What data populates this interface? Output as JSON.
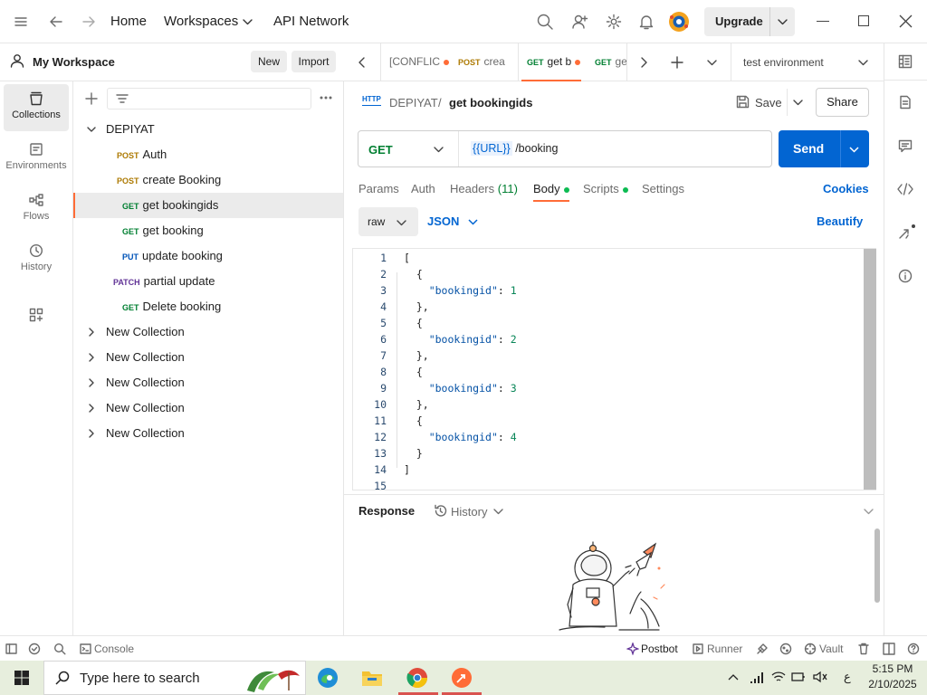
{
  "topbar": {
    "nav": [
      "Home",
      "Workspaces",
      "API Network"
    ],
    "upgrade": "Upgrade"
  },
  "workspace": {
    "name": "My Workspace",
    "new": "New",
    "import": "Import"
  },
  "rail": [
    "Collections",
    "Environments",
    "Flows",
    "History"
  ],
  "tree": {
    "collection": "DEPIYAT",
    "requests": [
      {
        "method": "POST",
        "name": "Auth"
      },
      {
        "method": "POST",
        "name": "create Booking"
      },
      {
        "method": "GET",
        "name": "get bookingids"
      },
      {
        "method": "GET",
        "name": "get booking"
      },
      {
        "method": "PUT",
        "name": "update booking"
      },
      {
        "method": "PATCH",
        "name": "partial update"
      },
      {
        "method": "GET",
        "name": "Delete booking"
      }
    ],
    "others": [
      "New Collection",
      "New Collection",
      "New Collection",
      "New Collection",
      "New Collection"
    ]
  },
  "tabs": [
    {
      "method": "",
      "label": "[CONFLIC"
    },
    {
      "method": "POST",
      "label": "crea"
    },
    {
      "method": "GET",
      "label": "get b"
    },
    {
      "method": "GET",
      "label": "ge"
    }
  ],
  "environment": "test environment",
  "breadcrumb": {
    "collection": "DEPIYAT",
    "sep": "/",
    "request": "get bookingids",
    "badge": "HTTP"
  },
  "actions": {
    "save": "Save",
    "share": "Share"
  },
  "request": {
    "method": "GET",
    "url_var": "{{URL}}",
    "url_path": " /booking",
    "send": "Send"
  },
  "subtabs": {
    "params": "Params",
    "auth": "Auth",
    "headers": "Headers",
    "headers_count": "(11)",
    "body": "Body",
    "scripts": "Scripts",
    "settings": "Settings",
    "cookies": "Cookies"
  },
  "body": {
    "mode": "raw",
    "format": "JSON",
    "beautify": "Beautify"
  },
  "editor": {
    "lines": [
      {
        "n": "1",
        "t": "["
      },
      {
        "n": "2",
        "t": "  {"
      },
      {
        "n": "3",
        "k": "\"bookingid\"",
        "v": "1"
      },
      {
        "n": "4",
        "t": "  },"
      },
      {
        "n": "5",
        "t": "  {"
      },
      {
        "n": "6",
        "k": "\"bookingid\"",
        "v": "2"
      },
      {
        "n": "7",
        "t": "  },"
      },
      {
        "n": "8",
        "t": "  {"
      },
      {
        "n": "9",
        "k": "\"bookingid\"",
        "v": "3"
      },
      {
        "n": "10",
        "t": "  },"
      },
      {
        "n": "11",
        "t": "  {"
      },
      {
        "n": "12",
        "k": "\"bookingid\"",
        "v": "4"
      },
      {
        "n": "13",
        "t": "  }"
      },
      {
        "n": "14",
        "t": "]"
      },
      {
        "n": "15",
        "t": ""
      }
    ]
  },
  "response": {
    "title": "Response",
    "history": "History"
  },
  "statusbar": {
    "console": "Console",
    "postbot": "Postbot",
    "runner": "Runner",
    "vault": "Vault"
  },
  "taskbar": {
    "search": "Type here to search",
    "time": "5:15 PM",
    "date": "2/10/2025",
    "lang": "ع"
  },
  "colors": {
    "accent": "#ff6c37",
    "send": "#0265d2",
    "get": "#007f31",
    "post": "#ad7a03",
    "put": "#0053b8",
    "patch": "#623497",
    "link": "#0265d2"
  }
}
